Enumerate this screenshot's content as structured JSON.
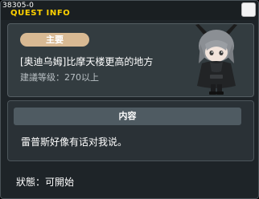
{
  "window": {
    "quest_id": "38305-0",
    "title": "QUEST INFO",
    "close_icon": "close-icon"
  },
  "quest": {
    "badge": "主要",
    "name": "[奥迪乌姆]比摩天楼更高的地方",
    "level_requirement": "建議等级：270以上"
  },
  "npc": {
    "icon": "npc-portrait"
  },
  "content": {
    "header": "内容",
    "text": "雷普斯好像有话对我说。"
  },
  "status": {
    "text": "狀態：可開始"
  },
  "colors": {
    "title_yellow": "#ffd200",
    "badge_tan": "#d8b993",
    "panel_bg": "#333c40"
  }
}
